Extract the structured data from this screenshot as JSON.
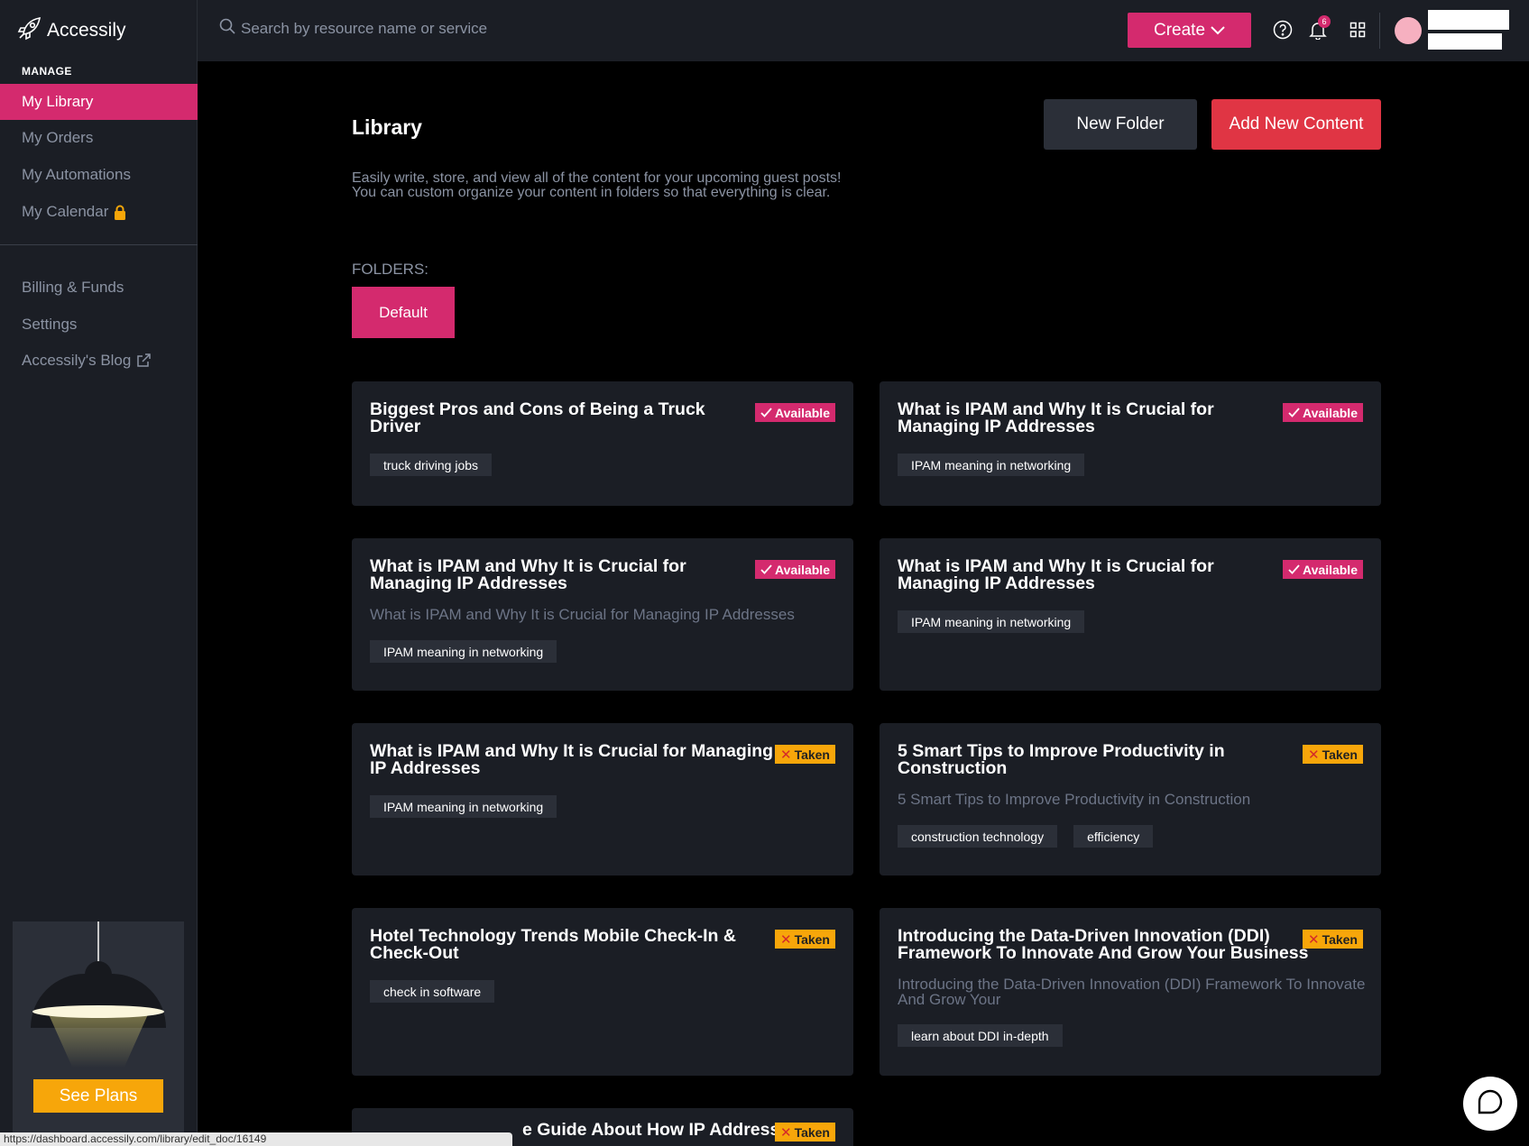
{
  "brand": {
    "name": "Accessily"
  },
  "sidebar": {
    "section_label": "MANAGE",
    "items": [
      {
        "label": "My Library",
        "active": true
      },
      {
        "label": "My Orders"
      },
      {
        "label": "My Automations"
      },
      {
        "label": "My Calendar",
        "icon": "lock-icon"
      },
      {
        "label": "Billing & Funds"
      },
      {
        "label": "Settings"
      },
      {
        "label": "Accessily's Blog",
        "icon": "external-link-icon"
      }
    ],
    "promo_button": "See Plans"
  },
  "topbar": {
    "search_placeholder": "Search by resource name or service",
    "create_label": "Create",
    "notification_count": "6"
  },
  "main": {
    "title": "Library",
    "new_folder_label": "New Folder",
    "add_content_label": "Add New Content",
    "description": "Easily write, store, and view all of the content for your upcoming guest posts! You can custom organize your content in folders so that everything is clear.",
    "folders_label": "FOLDERS:",
    "folders": [
      "Default"
    ]
  },
  "cards": [
    {
      "title": "Biggest Pros and Cons of Being a Truck Driver",
      "subtitle": "",
      "status": "Available",
      "tags": [
        "truck driving jobs"
      ]
    },
    {
      "title": "What is IPAM and Why It is Crucial for Managing IP Addresses",
      "subtitle": "",
      "status": "Available",
      "tags": [
        "IPAM meaning in networking"
      ]
    },
    {
      "title": "What is IPAM and Why It is Crucial for Managing IP Addresses",
      "subtitle": "What is IPAM and Why It is Crucial for Managing IP Addresses",
      "status": "Available",
      "tags": [
        "IPAM meaning in networking"
      ]
    },
    {
      "title": "What is IPAM and Why It is Crucial for Managing IP Addresses",
      "subtitle": "",
      "status": "Available",
      "tags": [
        "IPAM meaning in networking"
      ]
    },
    {
      "title": "What is IPAM and Why It is Crucial for Managing IP Addresses",
      "subtitle": "",
      "status": "Taken",
      "tags": [
        "IPAM meaning in networking"
      ]
    },
    {
      "title": "5 Smart Tips to Improve Productivity in Construction",
      "subtitle": "5 Smart Tips to Improve Productivity in Construction",
      "status": "Taken",
      "tags": [
        "construction technology",
        "efficiency"
      ]
    },
    {
      "title": "Hotel Technology Trends Mobile Check-In & Check-Out",
      "subtitle": "",
      "status": "Taken",
      "tags": [
        "check in software"
      ]
    },
    {
      "title": "Introducing the Data-Driven Innovation (DDI) Framework To Innovate And Grow Your Business",
      "subtitle": "Introducing the Data-Driven Innovation (DDI) Framework To Innovate And Grow Your",
      "status": "Taken",
      "tags": [
        "learn about DDI in-depth"
      ]
    },
    {
      "title": "e Guide About How IP Address",
      "subtitle": "",
      "status": "Taken",
      "tags": []
    }
  ],
  "status_bar_url": "https://dashboard.accessily.com/library/edit_doc/16149",
  "colors": {
    "accent": "#d42a6e",
    "danger": "#e03544",
    "warning": "#f7a60a",
    "panel": "#1b1e25"
  }
}
